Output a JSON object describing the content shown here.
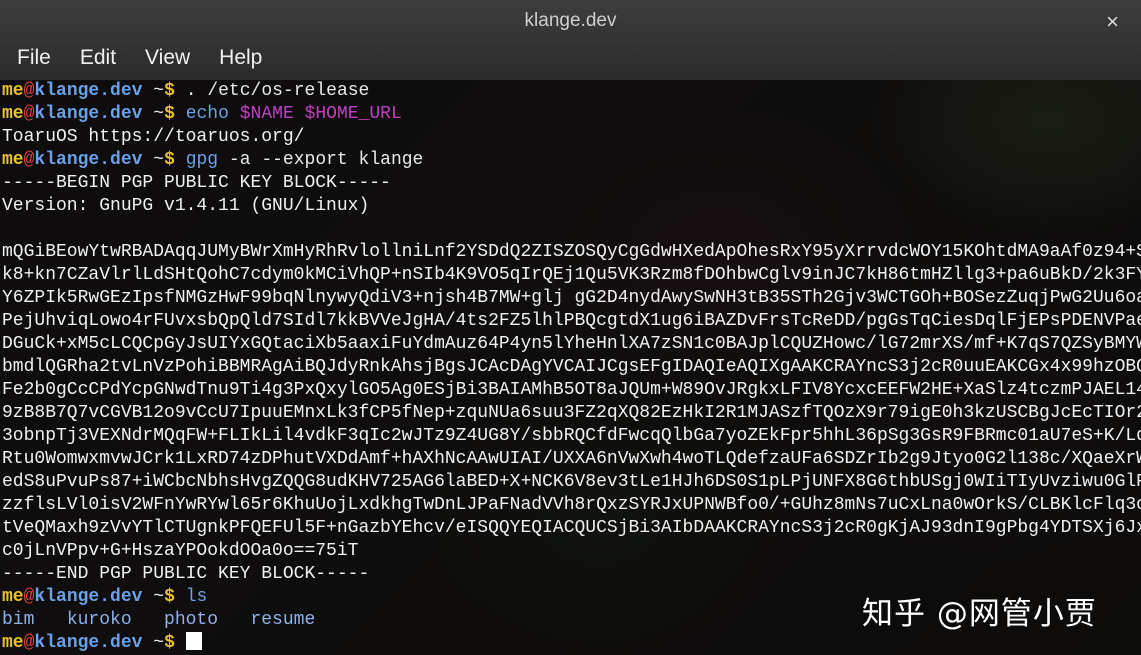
{
  "window": {
    "title": "klange.dev",
    "close_label": "×"
  },
  "menu": [
    "File",
    "Edit",
    "View",
    "Help"
  ],
  "prompt": {
    "user": "me",
    "at": "@",
    "host": "klange.dev",
    "dir": "~",
    "symbol": "$"
  },
  "lines": [
    {
      "cmd": ".",
      "rest": " /etc/os-release",
      "cmd_style": "plain"
    },
    {
      "cmd": "echo",
      "var1": "$NAME",
      "var2": "$HOME_URL"
    },
    "ToaruOS https://toaruos.org/",
    {
      "cmd": "gpg",
      "rest": " -a --export klange"
    },
    "-----BEGIN PGP PUBLIC KEY BLOCK-----",
    "Version: GnuPG v1.4.11 (GNU/Linux)",
    "",
    "mQGiBEowYtwRBADAqqJUMyBWrXmHyRhRvlollniLnf2YSDdQ2ZISZOSQyCgGdwHXedApOhesRxY95yXrrvdcWOY15KOhtdMA9aAf0z94+SwFliE18sve",
    "k8+kn7CZaVlrlLdSHtQohC7cdym0kMCiVhQP+nSIb4K9VO5qIrQEj1Qu5VK3Rzm8fDOhbwCglv9inJC7kH86tmHZllg3+pa6uBkD/2k3FYR33hPK/1nA",
    "Y6ZPIk5RwGEzIpsfNMGzHwF99bqNlnywyQdiV3+njsh4B7MW+glj gG2D4nydAwySwNH3tB35STh2Gjv3WCTGOh+BOSezZuqjPwG2Uu6oaiskUB7kN1Pb",
    "PejUhviqLowo4rFUvxsbQpQld7SIdl7kkBVVeJgHA/4ts2FZ5lhlPBQcgtdX1ug6iBAZDvFrsTcReDD/pgGsTqCiesDqlFjEPsPDENVPaepxp++yVF4p",
    "DGuCk+xM5cLCQCpGyJsUIYxGQtaciXb5aaxiFuYdmAuz64P4yn5lYheHnlXA7zSN1c0BAJplCQUZHowc/lG72mrXS/mf+K7qS7QZSyBMYW5nZSA8a2xh",
    "bmdlQGRha2tvLnVzPohiBBMRAgAiBQJdyRnkAhsjBgsJCAcDAgYVCAIJCgsEFgIDAQIeAQIXgAAKCRAYncS3j2cR0uuEAKCGx4x99hzOBQ67h/p09Z43",
    "Fe2b0gCcCPdYcpGNwdTnu9Ti4g3PxQxylGO5Ag0ESjBi3BAIAMhB5OT8aJQUm+W89OvJRgkxLFIV8YcxcEEFW2HE+XaSlz4tczmPJAEL14rPRwscX4zQ",
    "9zB8B7Q7vCGVB12o9vCcU7IpuuEMnxLk3fCP5fNep+zquNUa6suu3FZ2qXQ82EzHkI2R1MJASzfTQOzX9r79igE0h3kzUSCBgJcEcTIOr2MbmrLetfGf",
    "3obnpTj3VEXNdrMQqFW+FLIkLil4vdkF3qIc2wJTz9Z4UG8Y/sbbRQCfdFwcqQlbGa7yoZEkFpr5hhL36pSg3GsR9FBRmc01aU7eS+K/Lq/gnc85bgMq",
    "Rtu0WomwxmvwJCrk1LxRD74zDPhutVXDdAmf+hAXhNcAAwUIAI/UXXA6nVwXwh4woTLQdefzaUFa6SDZrIb2g9Jtyo0G2l138c/XQaeXrWLkDsbFfnFr",
    "edS8uPvuPs87+iWCbcNbhsHvgZQQG8udKHV725AG6laBED+X+NCK6V8ev3tLe1HJh6DS0S1pLPjUNFX8G6thbUSgj0WIiTIyUvziwu0GlP1N8+nbH+0G",
    "zzflsLVl0isV2WFnYwRYwl65r6KhuUojLxdkhgTwDnLJPaFNadVVh8rQxzSYRJxUPNWBfo0/+GUhz8mNs7uCxLna0wOrkS/CLBKlcFlq3oN5Bcw4tnl7",
    "tVeQMaxh9zVvYTlCTUgnkPFQEFUl5F+nGazbYEhcv/eISQQYEQIACQUCSjBi3AIbDAAKCRAYncS3j2cR0gKjAJ93dnI9gPbg4YDTSXj6Jx7QXvX1NQCf",
    "c0jLnVPpv+G+HszaYPOokdOOa0o==75iT",
    "-----END PGP PUBLIC KEY BLOCK-----",
    {
      "cmd": "ls"
    },
    {
      "files": [
        "bim",
        "kuroko",
        "photo",
        "resume"
      ]
    },
    {
      "cursor": true
    }
  ],
  "watermark": "知乎 @网管小贾"
}
